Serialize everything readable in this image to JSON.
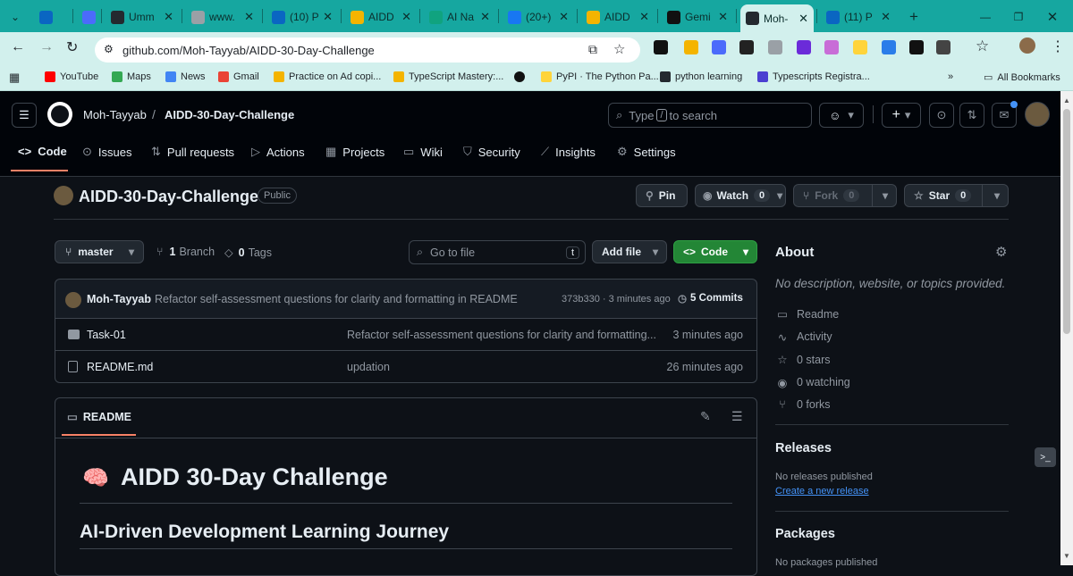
{
  "browser": {
    "tabs": [
      {
        "label": "",
        "color": "#0a66c2"
      },
      {
        "label": "",
        "color": "#4b6bfb"
      },
      {
        "label": "Umm",
        "color": "#24292f"
      },
      {
        "label": "www.",
        "color": "#9aa0a6"
      },
      {
        "label": "(10) P",
        "color": "#0a66c2"
      },
      {
        "label": "AIDD",
        "color": "#f4b400"
      },
      {
        "label": "AI Na",
        "color": "#10a37f"
      },
      {
        "label": "(20+)",
        "color": "#1877f2"
      },
      {
        "label": "AIDD",
        "color": "#f4b400"
      },
      {
        "label": "Gemi",
        "color": "#111111"
      },
      {
        "label": "Moh-",
        "color": "#24292f"
      },
      {
        "label": "(11) P",
        "color": "#0a66c2"
      }
    ],
    "url": "github.com/Moh-Tayyab/AIDD-30-Day-Challenge",
    "bookmarks": [
      {
        "label": "YouTube",
        "color": "#ff0000"
      },
      {
        "label": "Maps",
        "color": "#34a853"
      },
      {
        "label": "News",
        "color": "#4285f4"
      },
      {
        "label": "Gmail",
        "color": "#ea4335"
      },
      {
        "label": "Practice on Ad copi...",
        "color": "#f4b400"
      },
      {
        "label": "TypeScript Mastery:...",
        "color": "#f4b400"
      },
      {
        "label": "",
        "color": "#111111"
      },
      {
        "label": "PyPI · The Python Pa...",
        "color": "#ffd43b"
      },
      {
        "label": "python learning",
        "color": "#24292f"
      },
      {
        "label": "Typescripts Registra...",
        "color": "#4b3fd1"
      }
    ],
    "more_bookmarks": "»",
    "all_bookmarks": "All Bookmarks"
  },
  "header": {
    "owner": "Moh-Tayyab",
    "slash": "/",
    "repo": "AIDD-30-Day-Challenge",
    "search_prefix": "Type",
    "search_key": "/",
    "search_suffix": "to search",
    "plus": "+",
    "caret": "▾"
  },
  "nav": [
    {
      "label": "Code",
      "glyph": "<>"
    },
    {
      "label": "Issues",
      "glyph": "⊙"
    },
    {
      "label": "Pull requests",
      "glyph": "⇅"
    },
    {
      "label": "Actions",
      "glyph": "▷"
    },
    {
      "label": "Projects",
      "glyph": "▦"
    },
    {
      "label": "Wiki",
      "glyph": "▭"
    },
    {
      "label": "Security",
      "glyph": "⛉"
    },
    {
      "label": "Insights",
      "glyph": "⟋"
    },
    {
      "label": "Settings",
      "glyph": "⚙"
    }
  ],
  "repo": {
    "name": "AIDD-30-Day-Challenge",
    "visibility": "Public",
    "pin": "Pin",
    "watch": "Watch",
    "watch_count": "0",
    "fork": "Fork",
    "fork_count": "0",
    "star": "Star",
    "star_count": "0"
  },
  "files_bar": {
    "branch": "master",
    "branches_count": "1",
    "branches_label": "Branch",
    "tags_count": "0",
    "tags_label": "Tags",
    "goto_placeholder": "Go to file",
    "goto_key": "t",
    "add_file": "Add file",
    "code": "Code"
  },
  "commit": {
    "author": "Moh-Tayyab",
    "message": "Refactor self-assessment questions for clarity and formatting in README",
    "hash_time": "373b330 · 3 minutes ago",
    "commits": "5 Commits"
  },
  "files": [
    {
      "name": "Task-01",
      "type": "folder",
      "message": "Refactor self-assessment questions for clarity and formatting...",
      "time": "3 minutes ago"
    },
    {
      "name": "README.md",
      "type": "file",
      "message": "updation",
      "time": "26 minutes ago"
    }
  ],
  "readme": {
    "tab": "README",
    "emoji": "🧠",
    "h1": "AIDD 30-Day Challenge",
    "h2": "AI-Driven Development Learning Journey"
  },
  "about": {
    "title": "About",
    "description": "No description, website, or topics provided.",
    "links": [
      {
        "label": "Readme",
        "glyph": "▭"
      },
      {
        "label": "Activity",
        "glyph": "∿"
      },
      {
        "label": "0 stars",
        "glyph": "☆"
      },
      {
        "label": "0 watching",
        "glyph": "◉"
      },
      {
        "label": "0 forks",
        "glyph": "⑂"
      }
    ]
  },
  "releases": {
    "title": "Releases",
    "none": "No releases published",
    "create": "Create a new release"
  },
  "packages": {
    "title": "Packages",
    "none": "No packages published"
  }
}
